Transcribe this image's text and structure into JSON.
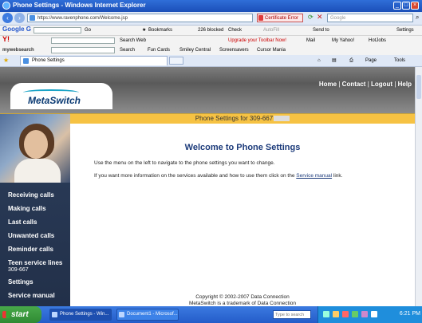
{
  "window": {
    "title": "Phone Settings - Windows Internet Explorer"
  },
  "addressbar": {
    "url": "https://www.ravenphone.com/Welcome.jsp",
    "certificate": "Certificate Error",
    "search_placeholder": "Google"
  },
  "google_toolbar": {
    "brand": "Google G",
    "go": "Go",
    "bookmarks": "Bookmarks",
    "blocked": "226 blocked",
    "check": "Check",
    "autofill": "AutoFill",
    "send_to": "Send to",
    "settings": "Settings"
  },
  "yahoo_toolbar": {
    "brand": "Y!",
    "search_web": "Search Web",
    "upgrade": "Upgrade your Toolbar Now!",
    "mail": "Mail",
    "my_yahoo": "My Yahoo!",
    "hotjobs": "HotJobs"
  },
  "mywebsearch_toolbar": {
    "brand": "mywebsearch",
    "search": "Search",
    "fun_cards": "Fun Cards",
    "smiley": "Smiley Central",
    "screensavers": "Screensavers",
    "cursor": "Cursor Mania"
  },
  "favbar": {
    "tab_title": "Phone Settings",
    "page": "Page",
    "tools": "Tools"
  },
  "header": {
    "logo": "MetaSwitch",
    "links": [
      "Home",
      "Contact",
      "Logout",
      "Help"
    ],
    "separator": "|"
  },
  "phone_bar": {
    "text": "Phone Settings for 309-667"
  },
  "nav": {
    "items": [
      {
        "label": "Receiving calls"
      },
      {
        "label": "Making calls"
      },
      {
        "label": "Last calls"
      },
      {
        "label": "Unwanted calls"
      },
      {
        "label": "Reminder calls"
      },
      {
        "label": "Teen service lines",
        "sub": "309-667"
      },
      {
        "label": "Settings"
      },
      {
        "label": "Service manual"
      }
    ]
  },
  "main": {
    "welcome": "Welcome to Phone Settings",
    "para1": "Use the menu on the left to navigate to the phone settings you want to change.",
    "para2_prefix": "If you want more information on the services available and how to use them click on the",
    "para2_link": "Service manual",
    "para2_suffix": "link."
  },
  "footer": {
    "copyright": "Copyright © 2002-2007 Data Connection",
    "trademark": "MetaSwitch is a trademark of Data Connection"
  },
  "taskbar": {
    "start": "start",
    "tasks": [
      "Phone Settings - Win...",
      "Document1 - Microsof..."
    ],
    "search_placeholder": "Type to search",
    "clock": "6:21 PM"
  }
}
